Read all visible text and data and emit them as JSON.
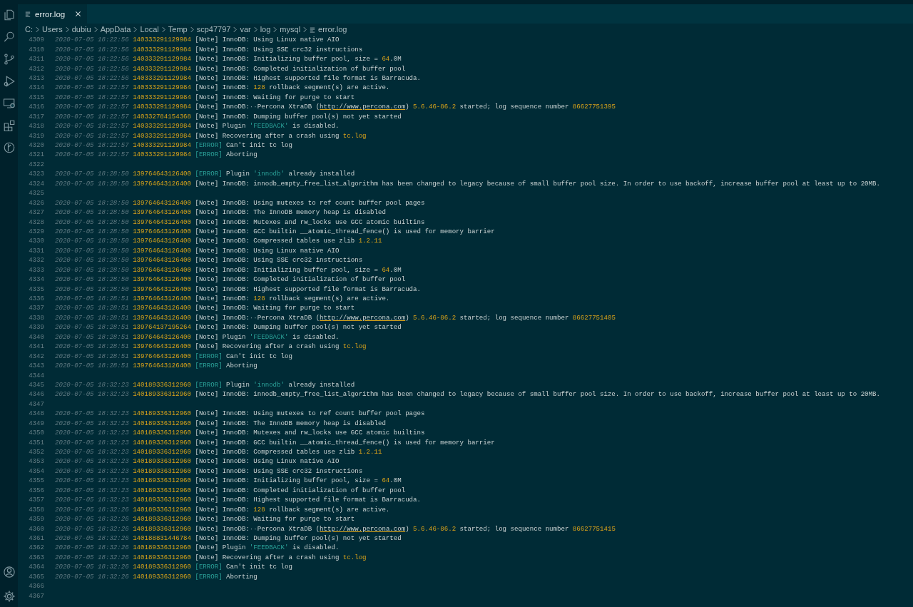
{
  "tab": {
    "label": "error.log",
    "selected": true
  },
  "breadcrumb": [
    "C:",
    "Users",
    "dubiu",
    "AppData",
    "Local",
    "Temp",
    "scp47797",
    "var",
    "log",
    "mysql",
    "error.log"
  ],
  "lines": [
    {
      "n": "4309",
      "date": "2020-07-05 18:22:56",
      "thread": "140333291129984",
      "level": "[Note]",
      "kind": "note",
      "msg": "InnoDB: Using Linux native AIO"
    },
    {
      "n": "4310",
      "date": "2020-07-05 18:22:56",
      "thread": "140333291129984",
      "level": "[Note]",
      "kind": "note",
      "msg": "InnoDB: Using SSE crc32 instructions"
    },
    {
      "n": "4311",
      "date": "2020-07-05 18:22:56",
      "thread": "140333291129984",
      "level": "[Note]",
      "kind": "note",
      "parts": [
        {
          "text": "InnoDB: Initializing buffer pool, size = ",
          "kind": "text"
        },
        {
          "text": "64",
          "kind": "number"
        },
        {
          "text": ".0M",
          "kind": "text"
        }
      ]
    },
    {
      "n": "4312",
      "date": "2020-07-05 18:22:56",
      "thread": "140333291129984",
      "level": "[Note]",
      "kind": "note",
      "msg": "InnoDB: Completed initialization of buffer pool"
    },
    {
      "n": "4313",
      "date": "2020-07-05 18:22:56",
      "thread": "140333291129984",
      "level": "[Note]",
      "kind": "note",
      "msg": "InnoDB: Highest supported file format is Barracuda."
    },
    {
      "n": "4314",
      "date": "2020-07-05 18:22:57",
      "thread": "140333291129984",
      "level": "[Note]",
      "kind": "note",
      "parts": [
        {
          "text": "InnoDB: ",
          "kind": "text"
        },
        {
          "text": "128",
          "kind": "number"
        },
        {
          "text": " rollback segment(s) are active.",
          "kind": "text"
        }
      ]
    },
    {
      "n": "4315",
      "date": "2020-07-05 18:22:57",
      "thread": "140333291129984",
      "level": "[Note]",
      "kind": "note",
      "msg": "InnoDB: Waiting for purge to start"
    },
    {
      "n": "4316",
      "date": "2020-07-05 18:22:57",
      "thread": "140333291129984",
      "level": "[Note]",
      "kind": "note",
      "parts": [
        {
          "text": "InnoDB:",
          "kind": "text"
        },
        {
          "text": "··",
          "kind": "whitespace"
        },
        {
          "text": "Percona XtraDB (",
          "kind": "text"
        },
        {
          "text": "http://www.percona.com",
          "kind": "link"
        },
        {
          "text": ") ",
          "kind": "text"
        },
        {
          "text": "5.6.46-86.2",
          "kind": "number"
        },
        {
          "text": " started; log sequence number ",
          "kind": "text"
        },
        {
          "text": "86627751395",
          "kind": "number"
        }
      ]
    },
    {
      "n": "4317",
      "date": "2020-07-05 18:22:57",
      "thread": "140332784154368",
      "level": "[Note]",
      "kind": "note",
      "msg": "InnoDB: Dumping buffer pool(s) not yet started"
    },
    {
      "n": "4318",
      "date": "2020-07-05 18:22:57",
      "thread": "140333291129984",
      "level": "[Note]",
      "kind": "note",
      "parts": [
        {
          "text": "Plugin ",
          "kind": "text"
        },
        {
          "text": "'FEEDBACK'",
          "kind": "string"
        },
        {
          "text": " is disabled.",
          "kind": "text"
        }
      ]
    },
    {
      "n": "4319",
      "date": "2020-07-05 18:22:57",
      "thread": "140333291129984",
      "level": "[Note]",
      "kind": "note",
      "parts": [
        {
          "text": "Recovering after a crash using ",
          "kind": "text"
        },
        {
          "text": "tc.log",
          "kind": "number"
        }
      ]
    },
    {
      "n": "4320",
      "date": "2020-07-05 18:22:57",
      "thread": "140333291129984",
      "level": "[ERROR]",
      "kind": "error",
      "msg": "Can't init tc log"
    },
    {
      "n": "4321",
      "date": "2020-07-05 18:22:57",
      "thread": "140333291129984",
      "level": "[ERROR]",
      "kind": "error",
      "msg": "Aborting"
    },
    {
      "n": "4322"
    },
    {
      "n": "4323",
      "date": "2020-07-05 18:28:50",
      "thread": "139764643126400",
      "level": "[ERROR]",
      "kind": "error",
      "parts": [
        {
          "text": "Plugin ",
          "kind": "text"
        },
        {
          "text": "'innodb'",
          "kind": "string"
        },
        {
          "text": " already installed",
          "kind": "text"
        }
      ]
    },
    {
      "n": "4324",
      "date": "2020-07-05 18:28:50",
      "thread": "139764643126400",
      "level": "[Note]",
      "kind": "note",
      "msg": "InnoDB: innodb_empty_free_list_algorithm has been changed to legacy because of small buffer pool size. In order to use backoff, increase buffer pool at least up to 20MB."
    },
    {
      "n": "4325"
    },
    {
      "n": "4326",
      "date": "2020-07-05 18:28:50",
      "thread": "139764643126400",
      "level": "[Note]",
      "kind": "note",
      "msg": "InnoDB: Using mutexes to ref count buffer pool pages"
    },
    {
      "n": "4327",
      "date": "2020-07-05 18:28:50",
      "thread": "139764643126400",
      "level": "[Note]",
      "kind": "note",
      "msg": "InnoDB: The InnoDB memory heap is disabled"
    },
    {
      "n": "4328",
      "date": "2020-07-05 18:28:50",
      "thread": "139764643126400",
      "level": "[Note]",
      "kind": "note",
      "msg": "InnoDB: Mutexes and rw_locks use GCC atomic builtins"
    },
    {
      "n": "4329",
      "date": "2020-07-05 18:28:50",
      "thread": "139764643126400",
      "level": "[Note]",
      "kind": "note",
      "msg": "InnoDB: GCC builtin __atomic_thread_fence() is used for memory barrier"
    },
    {
      "n": "4330",
      "date": "2020-07-05 18:28:50",
      "thread": "139764643126400",
      "level": "[Note]",
      "kind": "note",
      "parts": [
        {
          "text": "InnoDB: Compressed tables use zlib ",
          "kind": "text"
        },
        {
          "text": "1.2.11",
          "kind": "number"
        }
      ]
    },
    {
      "n": "4331",
      "date": "2020-07-05 18:28:50",
      "thread": "139764643126400",
      "level": "[Note]",
      "kind": "note",
      "msg": "InnoDB: Using Linux native AIO"
    },
    {
      "n": "4332",
      "date": "2020-07-05 18:28:50",
      "thread": "139764643126400",
      "level": "[Note]",
      "kind": "note",
      "msg": "InnoDB: Using SSE crc32 instructions"
    },
    {
      "n": "4333",
      "date": "2020-07-05 18:28:50",
      "thread": "139764643126400",
      "level": "[Note]",
      "kind": "note",
      "parts": [
        {
          "text": "InnoDB: Initializing buffer pool, size = ",
          "kind": "text"
        },
        {
          "text": "64",
          "kind": "number"
        },
        {
          "text": ".0M",
          "kind": "text"
        }
      ]
    },
    {
      "n": "4334",
      "date": "2020-07-05 18:28:50",
      "thread": "139764643126400",
      "level": "[Note]",
      "kind": "note",
      "msg": "InnoDB: Completed initialization of buffer pool"
    },
    {
      "n": "4335",
      "date": "2020-07-05 18:28:50",
      "thread": "139764643126400",
      "level": "[Note]",
      "kind": "note",
      "msg": "InnoDB: Highest supported file format is Barracuda."
    },
    {
      "n": "4336",
      "date": "2020-07-05 18:28:51",
      "thread": "139764643126400",
      "level": "[Note]",
      "kind": "note",
      "parts": [
        {
          "text": "InnoDB: ",
          "kind": "text"
        },
        {
          "text": "128",
          "kind": "number"
        },
        {
          "text": " rollback segment(s) are active.",
          "kind": "text"
        }
      ]
    },
    {
      "n": "4337",
      "date": "2020-07-05 18:28:51",
      "thread": "139764643126400",
      "level": "[Note]",
      "kind": "note",
      "msg": "InnoDB: Waiting for purge to start"
    },
    {
      "n": "4338",
      "date": "2020-07-05 18:28:51",
      "thread": "139764643126400",
      "level": "[Note]",
      "kind": "note",
      "parts": [
        {
          "text": "InnoDB:",
          "kind": "text"
        },
        {
          "text": "··",
          "kind": "whitespace"
        },
        {
          "text": "Percona XtraDB (",
          "kind": "text"
        },
        {
          "text": "http://www.percona.com",
          "kind": "link"
        },
        {
          "text": ") ",
          "kind": "text"
        },
        {
          "text": "5.6.46-86.2",
          "kind": "number"
        },
        {
          "text": " started; log sequence number ",
          "kind": "text"
        },
        {
          "text": "86627751405",
          "kind": "number"
        }
      ]
    },
    {
      "n": "4339",
      "date": "2020-07-05 18:28:51",
      "thread": "139764137195264",
      "level": "[Note]",
      "kind": "note",
      "msg": "InnoDB: Dumping buffer pool(s) not yet started"
    },
    {
      "n": "4340",
      "date": "2020-07-05 18:28:51",
      "thread": "139764643126400",
      "level": "[Note]",
      "kind": "note",
      "parts": [
        {
          "text": "Plugin ",
          "kind": "text"
        },
        {
          "text": "'FEEDBACK'",
          "kind": "string"
        },
        {
          "text": " is disabled.",
          "kind": "text"
        }
      ]
    },
    {
      "n": "4341",
      "date": "2020-07-05 18:28:51",
      "thread": "139764643126400",
      "level": "[Note]",
      "kind": "note",
      "parts": [
        {
          "text": "Recovering after a crash using ",
          "kind": "text"
        },
        {
          "text": "tc.log",
          "kind": "number"
        }
      ]
    },
    {
      "n": "4342",
      "date": "2020-07-05 18:28:51",
      "thread": "139764643126400",
      "level": "[ERROR]",
      "kind": "error",
      "msg": "Can't init tc log"
    },
    {
      "n": "4343",
      "date": "2020-07-05 18:28:51",
      "thread": "139764643126400",
      "level": "[ERROR]",
      "kind": "error",
      "msg": "Aborting"
    },
    {
      "n": "4344"
    },
    {
      "n": "4345",
      "date": "2020-07-05 18:32:23",
      "thread": "140189336312960",
      "level": "[ERROR]",
      "kind": "error",
      "parts": [
        {
          "text": "Plugin ",
          "kind": "text"
        },
        {
          "text": "'innodb'",
          "kind": "string"
        },
        {
          "text": " already installed",
          "kind": "text"
        }
      ]
    },
    {
      "n": "4346",
      "date": "2020-07-05 18:32:23",
      "thread": "140189336312960",
      "level": "[Note]",
      "kind": "note",
      "msg": "InnoDB: innodb_empty_free_list_algorithm has been changed to legacy because of small buffer pool size. In order to use backoff, increase buffer pool at least up to 20MB."
    },
    {
      "n": "4347"
    },
    {
      "n": "4348",
      "date": "2020-07-05 18:32:23",
      "thread": "140189336312960",
      "level": "[Note]",
      "kind": "note",
      "msg": "InnoDB: Using mutexes to ref count buffer pool pages"
    },
    {
      "n": "4349",
      "date": "2020-07-05 18:32:23",
      "thread": "140189336312960",
      "level": "[Note]",
      "kind": "note",
      "msg": "InnoDB: The InnoDB memory heap is disabled"
    },
    {
      "n": "4350",
      "date": "2020-07-05 18:32:23",
      "thread": "140189336312960",
      "level": "[Note]",
      "kind": "note",
      "msg": "InnoDB: Mutexes and rw_locks use GCC atomic builtins"
    },
    {
      "n": "4351",
      "date": "2020-07-05 18:32:23",
      "thread": "140189336312960",
      "level": "[Note]",
      "kind": "note",
      "msg": "InnoDB: GCC builtin __atomic_thread_fence() is used for memory barrier"
    },
    {
      "n": "4352",
      "date": "2020-07-05 18:32:23",
      "thread": "140189336312960",
      "level": "[Note]",
      "kind": "note",
      "parts": [
        {
          "text": "InnoDB: Compressed tables use zlib ",
          "kind": "text"
        },
        {
          "text": "1.2.11",
          "kind": "number"
        }
      ]
    },
    {
      "n": "4353",
      "date": "2020-07-05 18:32:23",
      "thread": "140189336312960",
      "level": "[Note]",
      "kind": "note",
      "msg": "InnoDB: Using Linux native AIO"
    },
    {
      "n": "4354",
      "date": "2020-07-05 18:32:23",
      "thread": "140189336312960",
      "level": "[Note]",
      "kind": "note",
      "msg": "InnoDB: Using SSE crc32 instructions"
    },
    {
      "n": "4355",
      "date": "2020-07-05 18:32:23",
      "thread": "140189336312960",
      "level": "[Note]",
      "kind": "note",
      "parts": [
        {
          "text": "InnoDB: Initializing buffer pool, size = ",
          "kind": "text"
        },
        {
          "text": "64",
          "kind": "number"
        },
        {
          "text": ".0M",
          "kind": "text"
        }
      ]
    },
    {
      "n": "4356",
      "date": "2020-07-05 18:32:23",
      "thread": "140189336312960",
      "level": "[Note]",
      "kind": "note",
      "msg": "InnoDB: Completed initialization of buffer pool"
    },
    {
      "n": "4357",
      "date": "2020-07-05 18:32:23",
      "thread": "140189336312960",
      "level": "[Note]",
      "kind": "note",
      "msg": "InnoDB: Highest supported file format is Barracuda."
    },
    {
      "n": "4358",
      "date": "2020-07-05 18:32:26",
      "thread": "140189336312960",
      "level": "[Note]",
      "kind": "note",
      "parts": [
        {
          "text": "InnoDB: ",
          "kind": "text"
        },
        {
          "text": "128",
          "kind": "number"
        },
        {
          "text": " rollback segment(s) are active.",
          "kind": "text"
        }
      ]
    },
    {
      "n": "4359",
      "date": "2020-07-05 18:32:26",
      "thread": "140189336312960",
      "level": "[Note]",
      "kind": "note",
      "msg": "InnoDB: Waiting for purge to start"
    },
    {
      "n": "4360",
      "date": "2020-07-05 18:32:26",
      "thread": "140189336312960",
      "level": "[Note]",
      "kind": "note",
      "parts": [
        {
          "text": "InnoDB:",
          "kind": "text"
        },
        {
          "text": "··",
          "kind": "whitespace"
        },
        {
          "text": "Percona XtraDB (",
          "kind": "text"
        },
        {
          "text": "http://www.percona.com",
          "kind": "link"
        },
        {
          "text": ") ",
          "kind": "text"
        },
        {
          "text": "5.6.46-86.2",
          "kind": "number"
        },
        {
          "text": " started; log sequence number ",
          "kind": "text"
        },
        {
          "text": "86627751415",
          "kind": "number"
        }
      ]
    },
    {
      "n": "4361",
      "date": "2020-07-05 18:32:26",
      "thread": "140188831446784",
      "level": "[Note]",
      "kind": "note",
      "msg": "InnoDB: Dumping buffer pool(s) not yet started"
    },
    {
      "n": "4362",
      "date": "2020-07-05 18:32:26",
      "thread": "140189336312960",
      "level": "[Note]",
      "kind": "note",
      "parts": [
        {
          "text": "Plugin ",
          "kind": "text"
        },
        {
          "text": "'FEEDBACK'",
          "kind": "string"
        },
        {
          "text": " is disabled.",
          "kind": "text"
        }
      ]
    },
    {
      "n": "4363",
      "date": "2020-07-05 18:32:26",
      "thread": "140189336312960",
      "level": "[Note]",
      "kind": "note",
      "parts": [
        {
          "text": "Recovering after a crash using ",
          "kind": "text"
        },
        {
          "text": "tc.log",
          "kind": "number"
        }
      ]
    },
    {
      "n": "4364",
      "date": "2020-07-05 18:32:26",
      "thread": "140189336312960",
      "level": "[ERROR]",
      "kind": "error",
      "msg": "Can't init tc log"
    },
    {
      "n": "4365",
      "date": "2020-07-05 18:32:26",
      "thread": "140189336312960",
      "level": "[ERROR]",
      "kind": "error",
      "msg": "Aborting"
    },
    {
      "n": "4366"
    },
    {
      "n": "4367"
    }
  ]
}
